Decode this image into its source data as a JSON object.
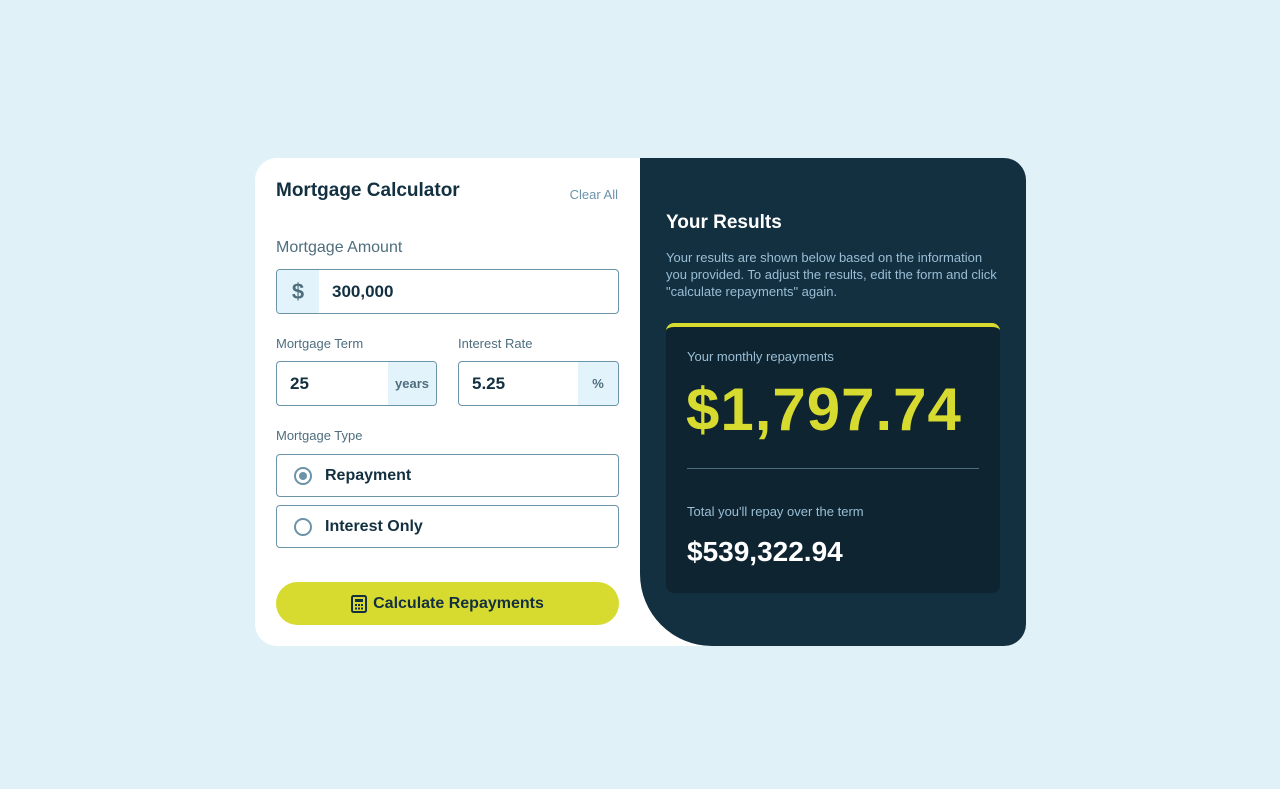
{
  "form": {
    "title": "Mortgage Calculator",
    "clear_all": "Clear All",
    "amount": {
      "label": "Mortgage Amount",
      "prefix": "$",
      "value": "300,000"
    },
    "term": {
      "label": "Mortgage Term",
      "value": "25",
      "suffix": "years"
    },
    "rate": {
      "label": "Interest Rate",
      "value": "5.25",
      "suffix": "%"
    },
    "type": {
      "label": "Mortgage Type",
      "options": [
        {
          "label": "Repayment",
          "checked": true
        },
        {
          "label": "Interest Only",
          "checked": false
        }
      ]
    },
    "submit_label": "Calculate Repayments",
    "submit_icon": "calculator-icon"
  },
  "results": {
    "title": "Your Results",
    "description": "Your results are shown below based on the information you provided. To adjust the results, edit the form and click \"calculate repayments\" again.",
    "monthly_label": "Your monthly repayments",
    "monthly_value": "$1,797.74",
    "total_label": "Total you'll repay over the term",
    "total_value": "$539,322.94"
  },
  "colors": {
    "background": "#e0f1f8",
    "dark_navy": "#133041",
    "lime": "#d8db2f",
    "slate": "#6b94a8"
  }
}
